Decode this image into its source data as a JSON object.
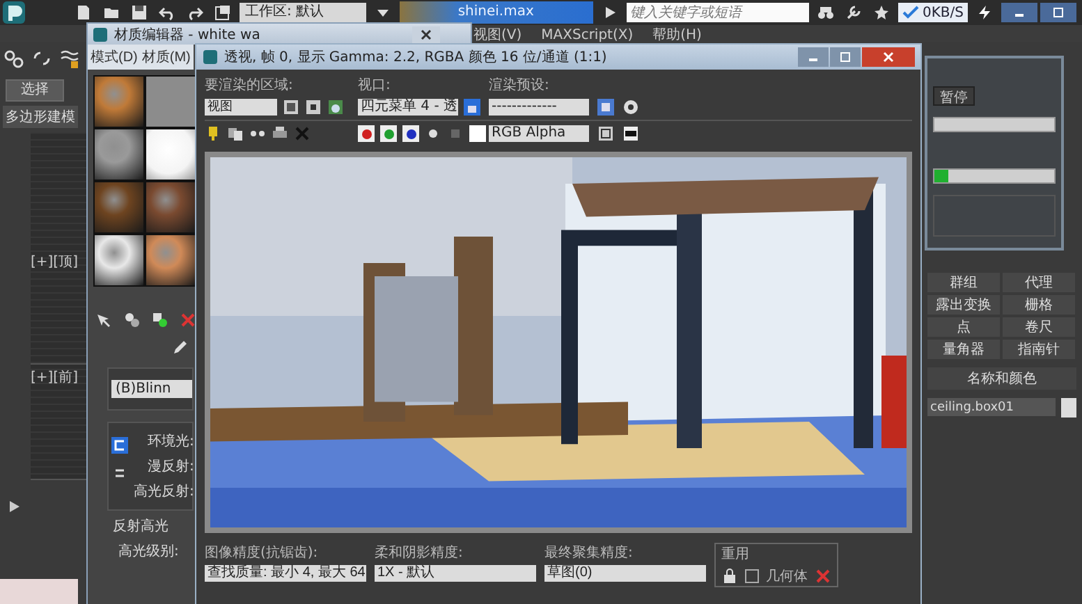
{
  "topbar": {
    "workspace": "工作区: 默认",
    "file_tab": "shinei.max",
    "search": {
      "placeholder": "键入关键字或短语"
    },
    "net_speed": "0KB/S"
  },
  "menubar": [
    "视图(V)",
    "MAXScript(X)",
    "帮助(H)"
  ],
  "left_panel": {
    "tabs": [
      {
        "label": "选择",
        "selected": true
      }
    ],
    "sub_label": "多边形建模",
    "viewports": [
      "[+][顶]",
      "[+][前]"
    ]
  },
  "material_editor": {
    "title": "材质编辑器 - white wa",
    "menu": [
      "模式(D)",
      "材质(M)"
    ],
    "slots": [
      {
        "kind": "sphere",
        "color": "#c07a38"
      },
      {
        "kind": "empty",
        "color": "#8c8c8c"
      },
      {
        "kind": "sphere",
        "color": "#9a9a9a"
      },
      {
        "kind": "glow",
        "color": "#f4f4f4"
      },
      {
        "kind": "sphere",
        "color": "#6e4420"
      },
      {
        "kind": "sphere",
        "color": "#7a4a30"
      },
      {
        "kind": "sphere",
        "color": "#e8e8e8"
      },
      {
        "kind": "sphere",
        "color": "#d08a58"
      }
    ],
    "shader": "(B)Blinn",
    "params": [
      "环境光:",
      "漫反射:",
      "高光反射:"
    ],
    "section": "反射高光",
    "spec_label": "高光级别:"
  },
  "render_window": {
    "title": "透视, 帧 0, 显示 Gamma: 2.2, RGBA 颜色 16 位/通道 (1:1)",
    "area_label": "要渲染的区域:",
    "area_value": "视图",
    "viewport_label": "视口:",
    "viewport_value": "四元菜单 4 - 透",
    "preset_label": "渲染预设:",
    "preset_value": "-------------",
    "channel_value": "RGB Alpha",
    "color_channels": [
      {
        "color": "#d02020"
      },
      {
        "color": "#20a030"
      },
      {
        "color": "#2030c0"
      }
    ],
    "bottom": [
      {
        "label": "图像精度(抗锯齿):",
        "value": "查找质量: 最小 4, 最大 64"
      },
      {
        "label": "柔和阴影精度:",
        "value": "1X - 默认"
      },
      {
        "label": "最终聚集精度:",
        "value": "草图(0)"
      }
    ],
    "reuse_label": "重用",
    "reuse_option": {
      "label": "几何体",
      "checked": false
    }
  },
  "progress_dialog": {
    "button": "暂停",
    "bars": [
      {
        "level": 0.12
      }
    ]
  },
  "command_panel": {
    "buttons": [
      "群组",
      "代理",
      "露出变换",
      "栅格",
      "点",
      "卷尺",
      "量角器",
      "指南针"
    ],
    "rollout": "名称和颜色",
    "name_field": "ceiling.box01"
  }
}
